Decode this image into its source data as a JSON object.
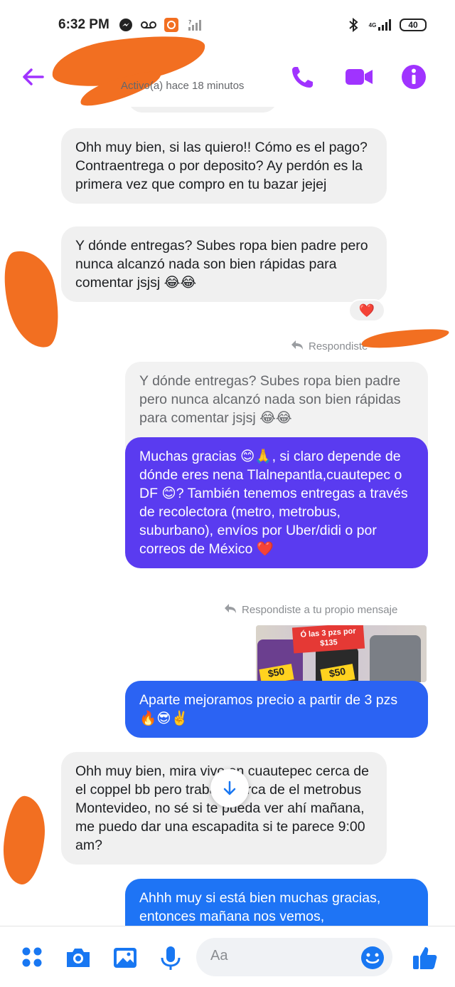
{
  "status_bar": {
    "time": "6:32 PM",
    "network": "4G",
    "battery": "40"
  },
  "header": {
    "back_icon": "arrow-left-icon",
    "contact_status": "Activo(a) hace 18 minutos",
    "call_icon": "phone-icon",
    "video_icon": "video-camera-icon",
    "info_icon": "info-icon",
    "accent": "#a033ff"
  },
  "messages": {
    "m1": "Ohh muy bien, si las quiero!! Cómo es el pago? Contraentrega o por deposito? Ay perdón es la primera vez que compro en tu bazar jejej",
    "m2": "Y dónde entregas? Subes ropa bien padre pero nunca alcanzó nada son bien rápidas para comentar jsjsj 😂😂",
    "m2_reaction": "❤️",
    "reply_note_1": "Respondiste",
    "quoted": "Y dónde entregas? Subes ropa bien padre pero nunca alcanzó nada son bien rápidas para comentar jsjsj 😂😂",
    "m3": "Muchas gracias 😊🙏, si claro depende de dónde eres nena Tlalnepantla,cuautepec o DF 😊? También tenemos entregas a través de recolectora (metro, metrobus, suburbano), envíos por Uber/didi o por correos de México ❤️",
    "reply_note_2": "Respondiste a tu propio mensaje",
    "image_caption": "Ó las 3 pzs por $135",
    "image_price_left": "$50",
    "image_price_mid": "$50",
    "m4": "Aparte mejoramos precio a partir de 3 pzs 🔥😎✌️",
    "m5": "Ohh muy bien, mira vivo en cuautepec cerca de el coppel bb pero trabajo cerca de el metrobus Montevideo, no sé si te pueda ver ahí mañana, me puedo dar una escapadita si te parece 9:00 am?",
    "m6": "Ahhh muy si está bien muchas gracias, entonces mañana nos vemos,"
  },
  "composer": {
    "placeholder": "Aa",
    "icons": [
      "apps-icon",
      "camera-icon",
      "image-icon",
      "microphone-icon",
      "emoji-icon",
      "thumbs-up-icon"
    ]
  },
  "colors": {
    "bubble_out_purple": "#5a3bf0",
    "bubble_out_blue": "#1e74f5",
    "bubble_in": "#f0f0f0",
    "accent": "#a033ff",
    "composer_blue": "#1877f2"
  }
}
